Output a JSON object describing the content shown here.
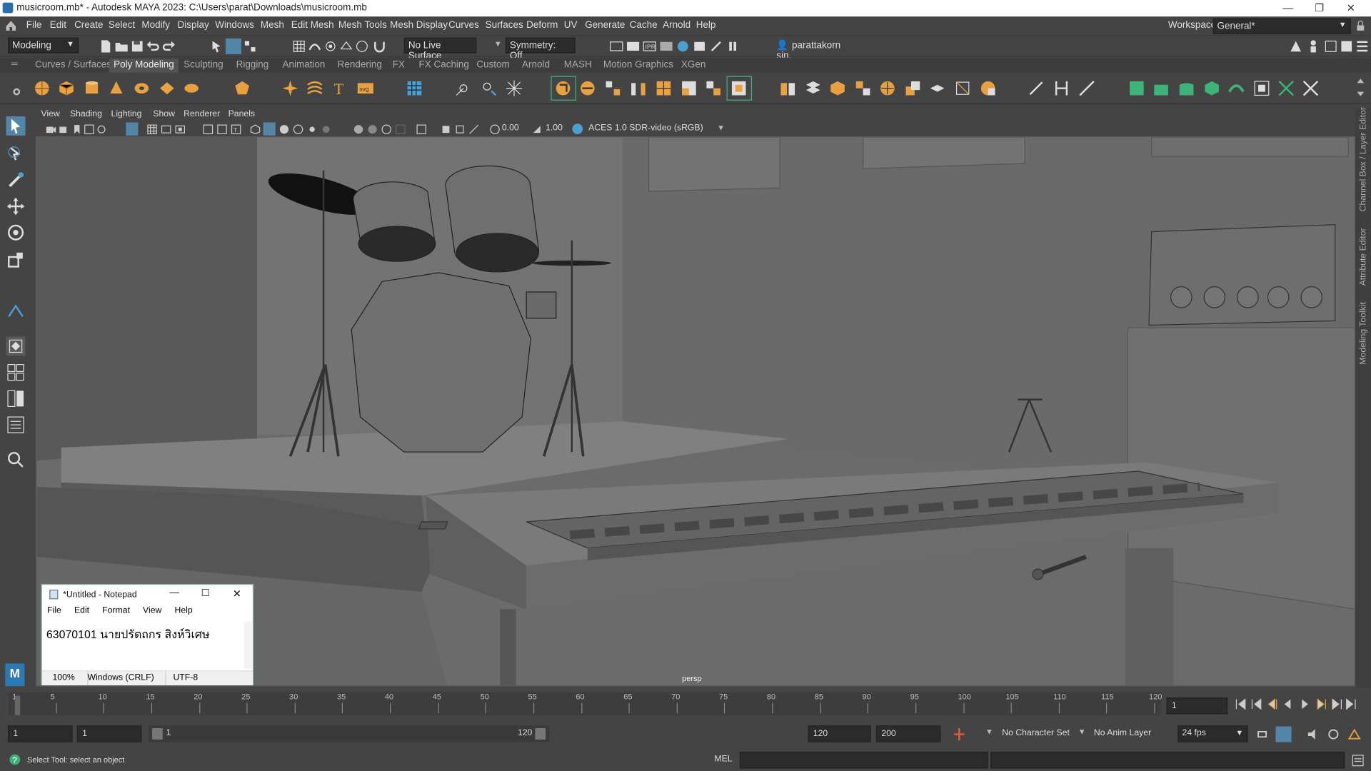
{
  "window": {
    "title": "musicroom.mb* - Autodesk MAYA 2023: C:\\Users\\parat\\Downloads\\musicroom.mb",
    "minimize": "—",
    "maximize": "❐",
    "close": "✕"
  },
  "menu": {
    "items": [
      "File",
      "Edit",
      "Create",
      "Select",
      "Modify",
      "Display",
      "Windows",
      "Mesh",
      "Edit Mesh",
      "Mesh Tools",
      "Mesh Display",
      "Curves",
      "Surfaces",
      "Deform",
      "UV",
      "Generate",
      "Cache",
      "Arnold",
      "Help"
    ],
    "workspace_label": "Workspace:",
    "workspace_value": "General*"
  },
  "statusline": {
    "menuset": "Modeling",
    "live_surface": "No Live Surface",
    "symmetry": "Symmetry: Off",
    "user": "parattakorn sin."
  },
  "shelf": {
    "tabs": [
      "Curves / Surfaces",
      "Poly Modeling",
      "Sculpting",
      "Rigging",
      "Animation",
      "Rendering",
      "FX",
      "FX Caching",
      "Custom",
      "Arnold",
      "MASH",
      "Motion Graphics",
      "XGen"
    ],
    "active_tab": "Poly Modeling"
  },
  "viewport": {
    "menu": [
      "View",
      "Shading",
      "Lighting",
      "Show",
      "Renderer",
      "Panels"
    ],
    "exposure": "0.00",
    "gamma": "1.00",
    "color_space": "ACES 1.0 SDR-video (sRGB)",
    "camera_label": "persp"
  },
  "side_panels": [
    "Channel Box / Layer Editor",
    "Attribute Editor",
    "Modeling Toolkit"
  ],
  "timeline": {
    "ticks": [
      "1",
      "5",
      "10",
      "15",
      "20",
      "25",
      "30",
      "35",
      "40",
      "45",
      "50",
      "55",
      "60",
      "65",
      "70",
      "75",
      "80",
      "85",
      "90",
      "95",
      "100",
      "105",
      "110",
      "115",
      "120"
    ],
    "current_frame": "1"
  },
  "range": {
    "start": "1",
    "playback_start": "1",
    "slider_start": "1",
    "slider_end": "120",
    "playback_end": "120",
    "end": "200",
    "character_set": "No Character Set",
    "anim_layer": "No Anim Layer",
    "fps": "24 fps"
  },
  "commandline": {
    "help_text": "Select Tool: select an object",
    "language": "MEL"
  },
  "notepad": {
    "title": "*Untitled - Notepad",
    "menu": [
      "File",
      "Edit",
      "Format",
      "View",
      "Help"
    ],
    "content": "63070101 นายปรัตถกร สิงห์วิเศษ",
    "zoom": "100%",
    "line_ending": "Windows (CRLF)",
    "encoding": "UTF-8"
  },
  "colors": {
    "accent": "#e8a040",
    "highlight": "#5285a6",
    "green_icons": "#3db37a"
  }
}
